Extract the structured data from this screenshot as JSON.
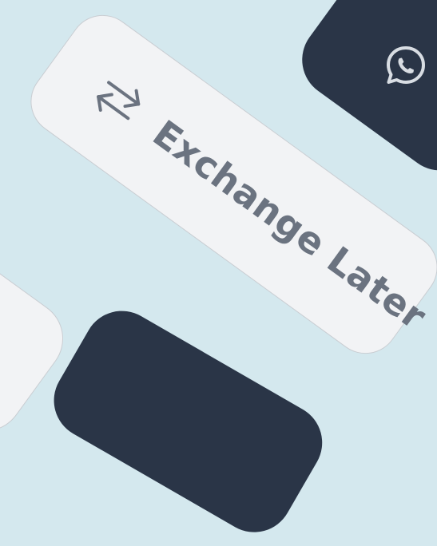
{
  "buttons": {
    "exchange_later": {
      "label": "Exchange Later",
      "icon": "exchange-arrows-icon"
    },
    "whatsapp": {
      "icon": "whatsapp-icon"
    }
  },
  "colors": {
    "background": "#d4e8ee",
    "light_pill": "#f2f3f5",
    "dark_pill": "#2a3547",
    "label_text": "#6b7380",
    "icon_light": "#d8dde3"
  }
}
